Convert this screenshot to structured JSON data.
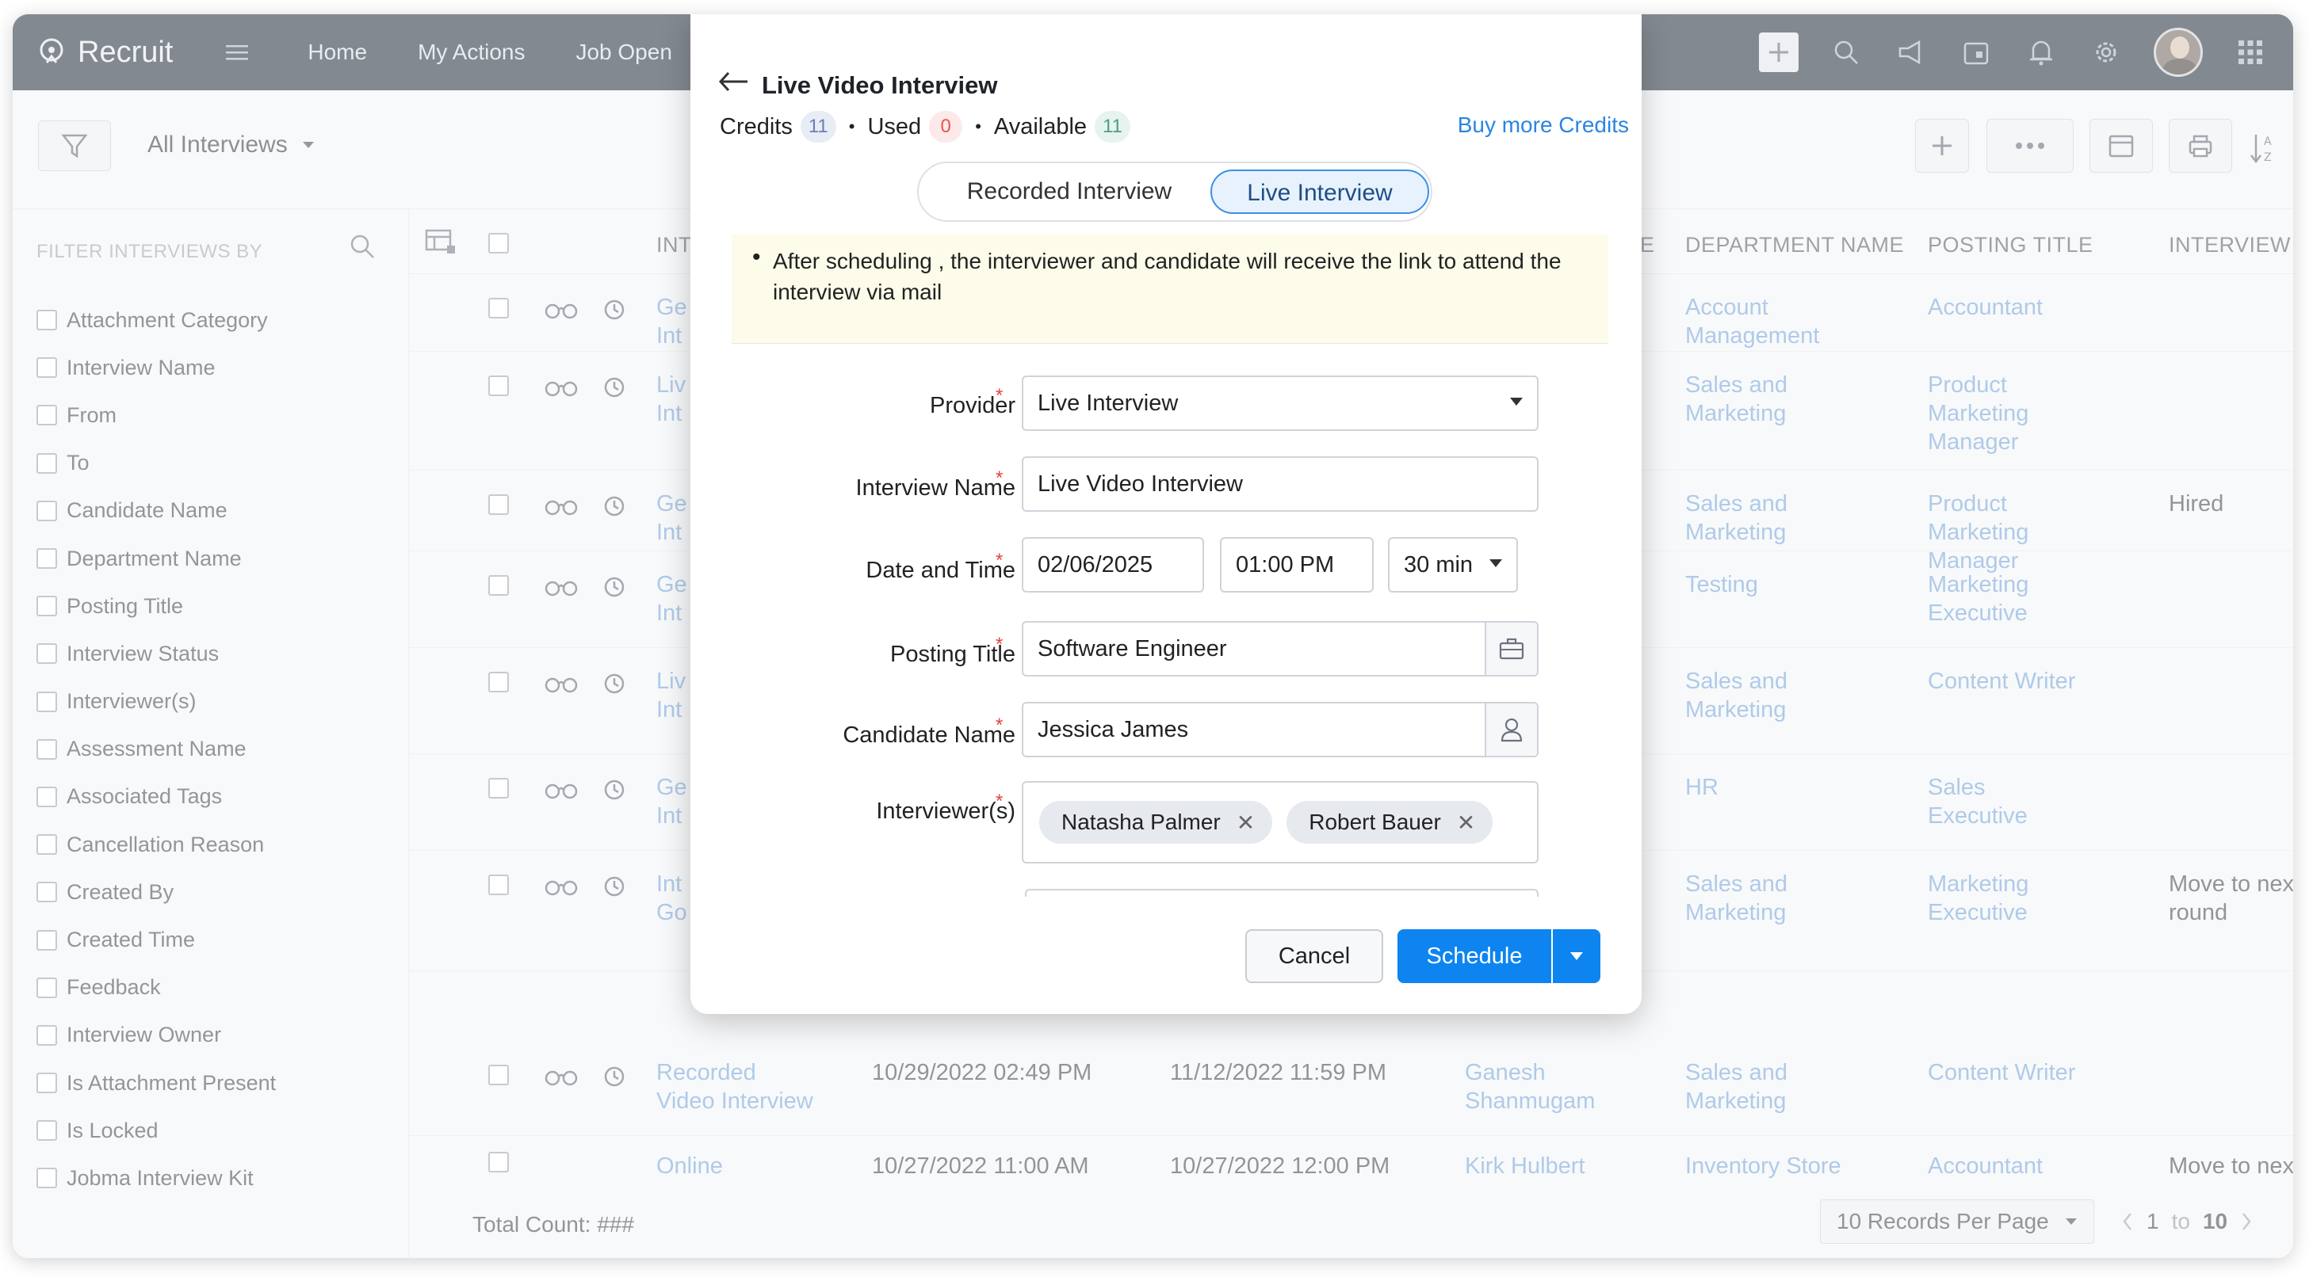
{
  "app": {
    "name": "Recruit",
    "nav": [
      "Home",
      "My Actions",
      "Job Open"
    ]
  },
  "toolbar": {
    "view": "All Interviews"
  },
  "filters": {
    "heading": "FILTER INTERVIEWS BY",
    "items": [
      "Attachment Category",
      "Interview Name",
      "From",
      "To",
      "Candidate Name",
      "Department Name",
      "Posting Title",
      "Interview Status",
      "Interviewer(s)",
      "Assessment Name",
      "Associated Tags",
      "Cancellation Reason",
      "Created By",
      "Created Time",
      "Feedback",
      "Interview Owner",
      "Is Attachment Present",
      "Is Locked",
      "Jobma Interview Kit"
    ]
  },
  "table": {
    "headers": {
      "interview": "INT",
      "me": "ME",
      "department": "DEPARTMENT NAME",
      "posting": "POSTING TITLE",
      "status": "INTERVIEW STA"
    },
    "rows": [
      {
        "name1": "Ge",
        "name2": "Int",
        "dept1": "Account",
        "dept2": "Management",
        "post1": "Accountant",
        "post2": "",
        "post3": "",
        "status1": "",
        "status2": ""
      },
      {
        "name1": "Liv",
        "name2": "Int",
        "dept1": "Sales and",
        "dept2": "Marketing",
        "post1": "Product",
        "post2": "Marketing",
        "post3": "Manager",
        "status1": "",
        "status2": ""
      },
      {
        "name1": "Ge",
        "name2": "Int",
        "dept1": "Sales and",
        "dept2": "Marketing",
        "post1": "Product",
        "post2": "Marketing",
        "post3": "Manager",
        "status1": "Hired",
        "status2": ""
      },
      {
        "name1": "Ge",
        "name2": "Int",
        "dept1": "Testing",
        "dept2": "",
        "post1": "Marketing",
        "post2": "Executive",
        "post3": "",
        "status1": "",
        "status2": ""
      },
      {
        "name1": "Liv",
        "name2": "Int",
        "dept1": "Sales and",
        "dept2": "Marketing",
        "post1": "Content Writer",
        "post2": "",
        "post3": "",
        "status1": "",
        "status2": ""
      },
      {
        "name1": "Ge",
        "name2": "Int",
        "dept1": "HR",
        "dept2": "",
        "post1": "Sales",
        "post2": "Executive",
        "post3": "",
        "status1": "",
        "status2": ""
      },
      {
        "name1": "Int",
        "name2": "Go",
        "dept1": "Sales and",
        "dept2": "Marketing",
        "post1": "Marketing",
        "post2": "Executive",
        "post3": "",
        "status1": "Move to next",
        "status2": "round"
      }
    ],
    "full_row": {
      "name1": "Recorded",
      "name2": "Video Interview",
      "from": "10/29/2022 02:49 PM",
      "to": "11/12/2022 11:59 PM",
      "cand1": "Ganesh",
      "cand2": "Shanmugam",
      "dept1": "Sales and",
      "dept2": "Marketing",
      "post": "Content Writer"
    },
    "partial_row": {
      "name": "Online",
      "from": "10/27/2022 11:00 AM",
      "to": "10/27/2022 12:00 PM",
      "cand": "Kirk Hulbert",
      "dept": "Inventory Store",
      "post": "Accountant",
      "status": "Move to next"
    }
  },
  "footer": {
    "total": "Total Count: ###",
    "per_page": "10 Records Per Page",
    "range_start": "1",
    "range_to": "to",
    "range_end": "10"
  },
  "modal": {
    "title": "Live Video Interview",
    "credits_label": "Credits",
    "credits": "11",
    "used_label": "Used",
    "used": "0",
    "available_label": "Available",
    "available": "11",
    "buy_link": "Buy more Credits",
    "tab_recorded": "Recorded Interview",
    "tab_live": "Live Interview",
    "info": "After scheduling , the interviewer and candidate will receive the link to attend the interview via mail",
    "fields": {
      "provider_label": "Provider",
      "provider_value": "Live Interview",
      "name_label": "Interview Name",
      "name_value": "Live Video Interview",
      "datetime_label": "Date and Time",
      "date_value": "02/06/2025",
      "time_value": "01:00 PM",
      "duration_value": "30 min",
      "posting_label": "Posting Title",
      "posting_value": "Software Engineer",
      "candidate_label": "Candidate Name",
      "candidate_value": "Jessica James",
      "interviewers_label": "Interviewer(s)",
      "interviewers": [
        "Natasha Palmer",
        "Robert Bauer"
      ]
    },
    "cancel": "Cancel",
    "schedule": "Schedule"
  },
  "colors": {
    "navbar": "#1e2936",
    "primary": "#0d84f0",
    "link": "#6d9fd8",
    "required": "#e0453c"
  }
}
